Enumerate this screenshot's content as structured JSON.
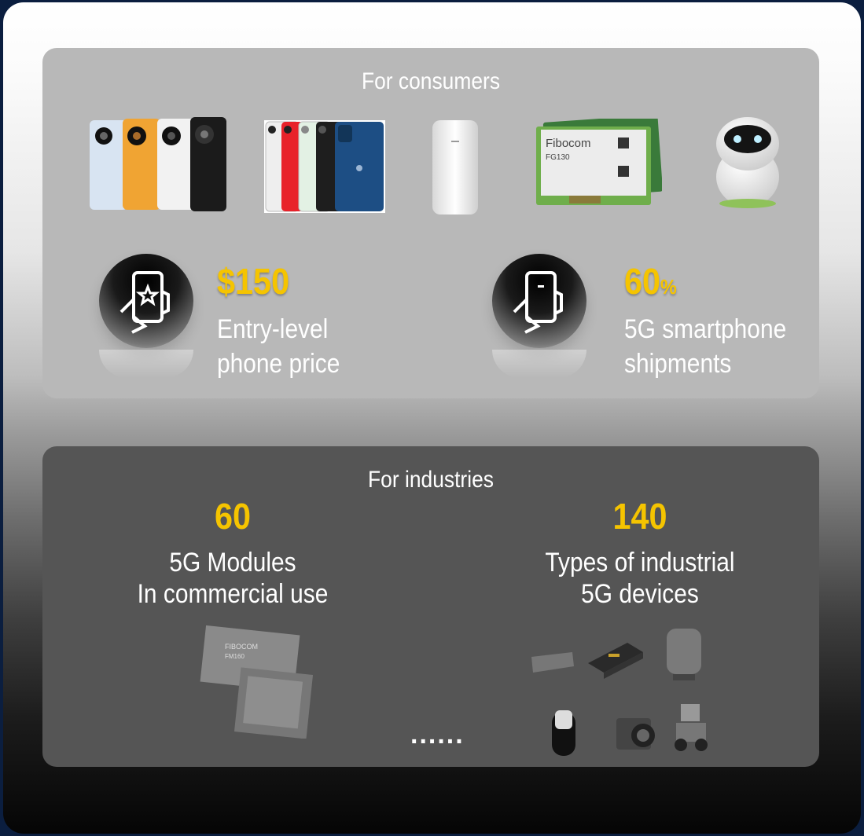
{
  "consumers": {
    "title": "For consumers",
    "stats": [
      {
        "value": "$150",
        "unit": "",
        "label_line1": "Entry-level",
        "label_line2": "phone price",
        "icon": "phone-star-icon"
      },
      {
        "value": "60",
        "unit": "%",
        "label_line1": "5G smartphone",
        "label_line2": "shipments",
        "icon": "phone-hand-icon"
      }
    ],
    "product_images": [
      "huawei-phones-image",
      "iphones-image",
      "cpe-router-image",
      "fibocom-module-image",
      "robot-image"
    ],
    "module_brand": "Fibocom",
    "module_model": "FG130"
  },
  "industries": {
    "title": "For industries",
    "stats": [
      {
        "value": "60",
        "label_line1": "5G Modules",
        "label_line2": "In commercial use"
      },
      {
        "value": "140",
        "label_line1": "Types of industrial",
        "label_line2": "5G devices"
      }
    ],
    "ellipsis": "......",
    "module_brand": "FIBOCOM",
    "module_model": "FM160"
  },
  "colors": {
    "accent": "#f5c400",
    "panel_light": "#b8b8b8",
    "panel_dark": "#555555",
    "outer_bg": "#0b1e3f"
  }
}
